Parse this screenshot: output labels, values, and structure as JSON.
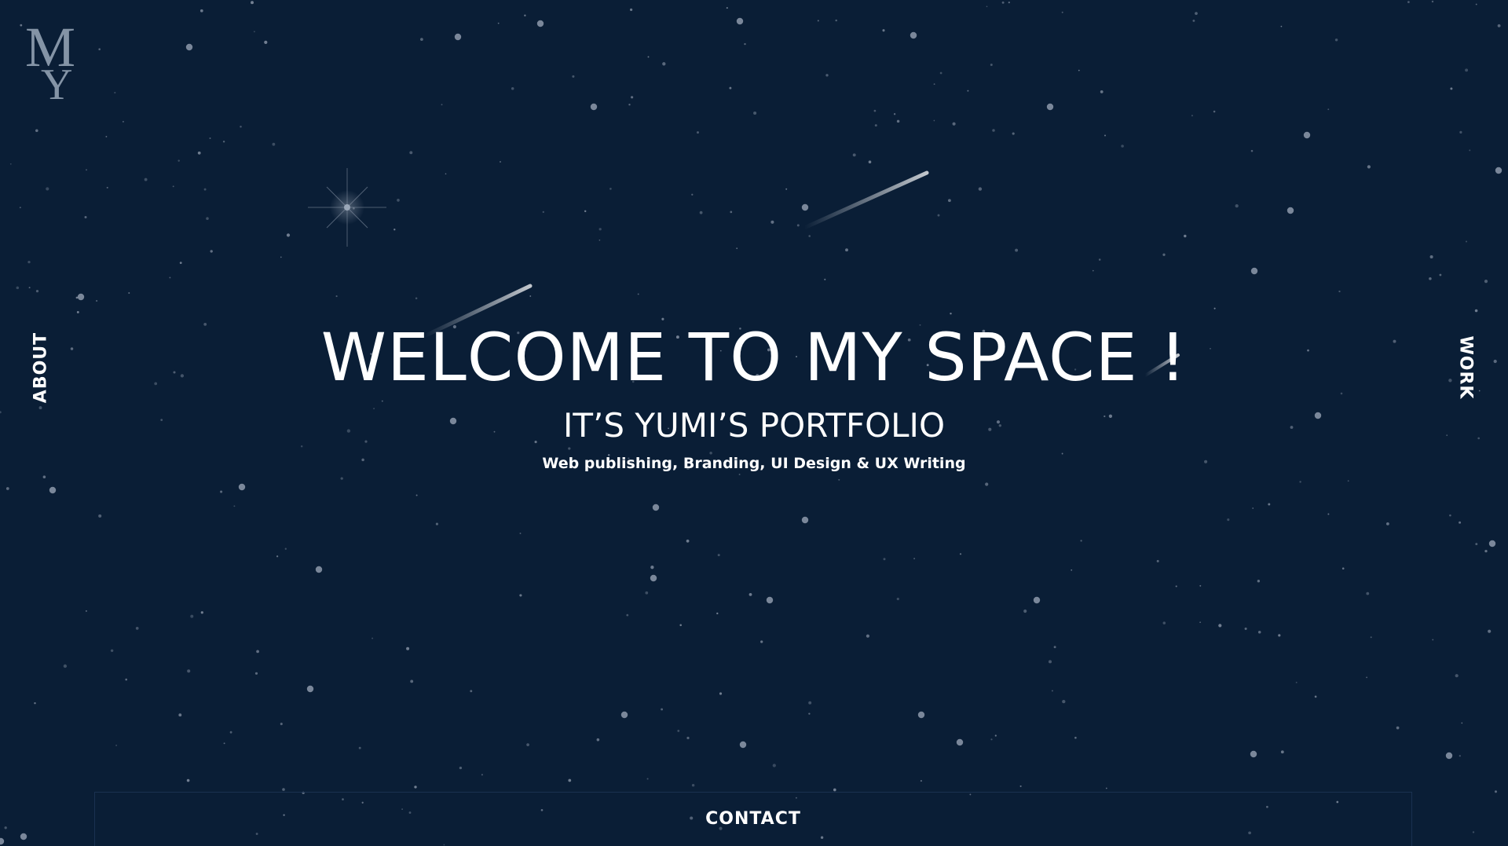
{
  "logo": {
    "top_letter": "M",
    "bottom_letter": "Y"
  },
  "nav": {
    "about": "ABOUT",
    "work": "WORK",
    "contact": "CONTACT"
  },
  "hero": {
    "title": "WELCOME TO MY SPACE !",
    "subtitle": "IT’S YUMI’S PORTFOLIO",
    "tagline": "Web publishing, Branding, UI Design & UX Writing"
  },
  "theme": {
    "background": "#0a1e36",
    "star": "#8e9aab",
    "text": "#ffffff",
    "logo": "#8494a6"
  },
  "icons": [
    "twinkle-star-icon",
    "shooting-star-icon"
  ]
}
